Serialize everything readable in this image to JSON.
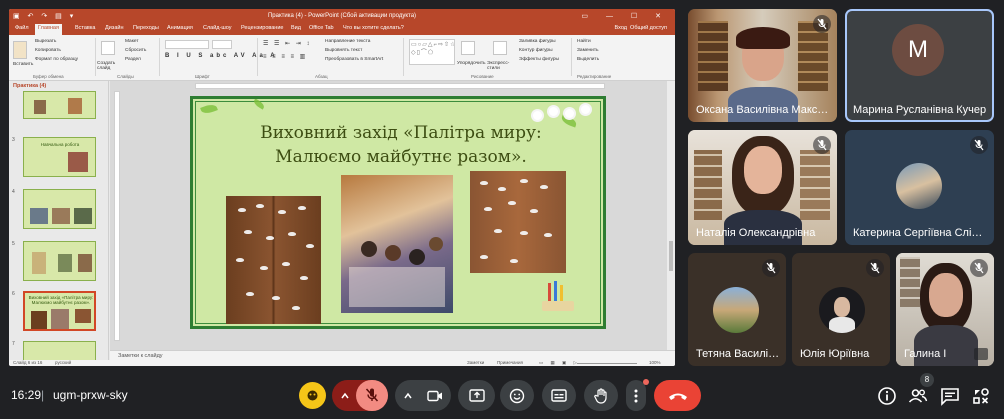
{
  "ppt": {
    "window_title": "Практика (4) - PowerPoint (Сбой активации продукта)",
    "tabs": [
      "Файл",
      "Главная",
      "Вставка",
      "Дизайн",
      "Переходы",
      "Анимация",
      "Слайд-шоу",
      "Рецензирование",
      "Вид",
      "Office Tab",
      "Что вы хотите сделать?"
    ],
    "right_tabs": [
      "Вход",
      "Общий доступ"
    ],
    "ribbon": {
      "paste": "Вставить",
      "cut": "Вырезать",
      "copy": "Копировать",
      "format_painter": "Формат по образцу",
      "clipboard_group": "Буфер обмена",
      "new_slide": "Создать слайд",
      "layout": "Макет",
      "reset": "Сбросить",
      "section": "Раздел",
      "slides_group": "Слайды",
      "font_group": "Шрифт",
      "text_direction": "Направление текста",
      "align_text": "Выровнять текст",
      "smartart": "Преобразовать в SmartArt",
      "paragraph_group": "Абзац",
      "arrange": "Упорядочить",
      "quick_styles": "Экспресс-стили",
      "shape_fill": "Заливка фигуры",
      "shape_outline": "Контур фигуры",
      "shape_effects": "Эффекты фигуры",
      "drawing_group": "Рисование",
      "find": "Найти",
      "replace": "Заменить",
      "select": "Выделить",
      "editing_group": "Редактирование"
    },
    "thumbs_header": "Практика (4)",
    "thumb_numbers": [
      "3",
      "4",
      "5",
      "6",
      "7"
    ],
    "thumb_titles": [
      "",
      "Навчальна робота",
      "",
      "",
      "Виховний захід «Палітра миру: Малюємо майбутнє разом»."
    ],
    "slide_title_line1": "Виховний захід «Палітра миру:",
    "slide_title_line2": "Малюємо майбутнє разом».",
    "notes_placeholder": "Заметки к слайду",
    "status_left": "Слайд 6 из 16",
    "status_lang": "русский",
    "status_notes": "Заметки",
    "status_comments": "Примечания",
    "zoom": "100%"
  },
  "participants": [
    {
      "name": "Оксана Василівна Максименко",
      "muted": true
    },
    {
      "name": "Марина Русланівна Кучер",
      "initial": "M",
      "muted": false
    },
    {
      "name": "Наталія Олександрівна",
      "muted": true
    },
    {
      "name": "Катерина Сергіївна Сліпенко",
      "muted": true
    },
    {
      "name": "Тетяна Василівна",
      "muted": true
    },
    {
      "name": "Юлія Юріївна",
      "muted": true
    },
    {
      "name": "Галина І",
      "muted": true
    }
  ],
  "bar": {
    "time": "16:29",
    "separator": "|",
    "meeting_code": "ugm-prxw-sky",
    "people_count": "8"
  },
  "colors": {
    "ppt_accent": "#b7472a",
    "meet_bg": "#202124",
    "tile_bg": "#3c4043",
    "hangup": "#ea4335",
    "mic_off": "#8c1d18",
    "avatar_m": "#6d4c41"
  }
}
